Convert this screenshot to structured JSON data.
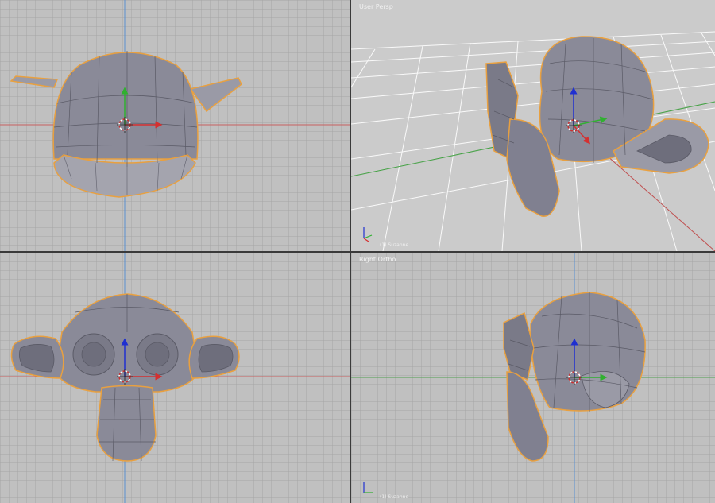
{
  "app": "Blender",
  "viewports": {
    "top_left": {
      "view": "top",
      "object_label": ""
    },
    "top_right": {
      "view": "perspective",
      "title": "User Persp",
      "object_label": "(1) Suzanne"
    },
    "bottom_left": {
      "view": "front",
      "object_label": ""
    },
    "bottom_right": {
      "view": "right",
      "title": "Right Ortho",
      "object_label": "(1) Suzanne"
    }
  },
  "colors": {
    "viewport_bg": "#c0c0c0",
    "grid_line": "#a4a4a4",
    "x_axis": "#c85a5a",
    "y_axis": "#5aa35a",
    "z_axis": "#4a4ac8",
    "mesh_fill": "#8a8a98",
    "mesh_edge": "#5a5a66",
    "selection_outline": "#e8a040",
    "separator": "#3a3a3a"
  },
  "icons": [
    "3d-cursor-icon",
    "transform-gizmo-icon",
    "axis-orientation-icon"
  ]
}
